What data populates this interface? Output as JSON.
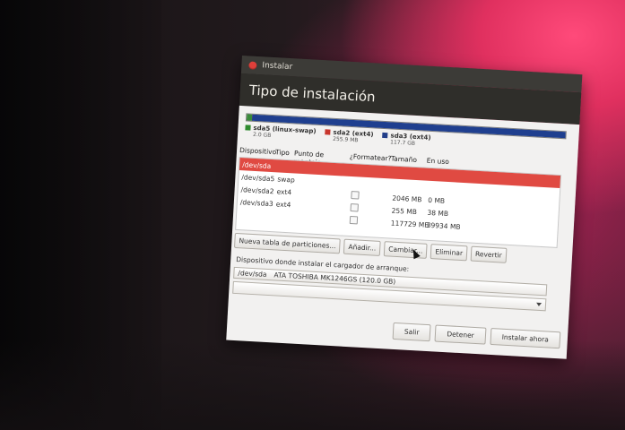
{
  "window": {
    "title": "Instalar",
    "header": "Tipo de instalación"
  },
  "partition_bar": {
    "segments": [
      {
        "color": "#3a8a3a",
        "fraction": 0.016
      },
      {
        "color": "#c8362d",
        "fraction": 0.002
      },
      {
        "color": "#1f3f8f",
        "fraction": 0.982
      }
    ]
  },
  "legend": [
    {
      "name": "sda5 (linux-swap)",
      "size": "2.0 GB",
      "color": "#2f8a2f"
    },
    {
      "name": "sda2 (ext4)",
      "size": "255.9 MB",
      "color": "#c8362d"
    },
    {
      "name": "sda3 (ext4)",
      "size": "117.7 GB",
      "color": "#233f8a"
    }
  ],
  "columns": [
    "Dispositivo",
    "Tipo",
    "Punto de montaje",
    "¿Formatear?",
    "Tamaño",
    "En uso"
  ],
  "rows": [
    {
      "device": "/dev/sda",
      "type": "",
      "mount": "",
      "size": "",
      "used": "",
      "format_checkbox": false,
      "selected": true
    },
    {
      "device": "/dev/sda5",
      "type": "swap",
      "mount": "",
      "size": "",
      "used": "",
      "format_checkbox": false,
      "selected": false
    },
    {
      "device": "/dev/sda2",
      "type": "ext4",
      "mount": "",
      "size": "2046 MB",
      "used": "0 MB",
      "format_checkbox": true,
      "selected": false
    },
    {
      "device": "/dev/sda3",
      "type": "ext4",
      "mount": "",
      "size": "255 MB",
      "used": "38 MB",
      "format_checkbox": true,
      "selected": false
    },
    {
      "device": "",
      "type": "",
      "mount": "",
      "size": "117729 MB",
      "used": "39934 MB",
      "format_checkbox": true,
      "selected": false
    }
  ],
  "partition_buttons": {
    "new_table": "Nueva tabla de particiones...",
    "add": "Añadir...",
    "change": "Cambiar...",
    "delete": "Eliminar",
    "revert": "Revertir"
  },
  "bootloader": {
    "label": "Dispositivo donde instalar el cargador de arranque:",
    "device": "/dev/sda",
    "description": "ATA TOSHIBA MK1246GS (120.0 GB)"
  },
  "actions": {
    "quit": "Salir",
    "stop": "Detener",
    "install": "Instalar ahora"
  }
}
